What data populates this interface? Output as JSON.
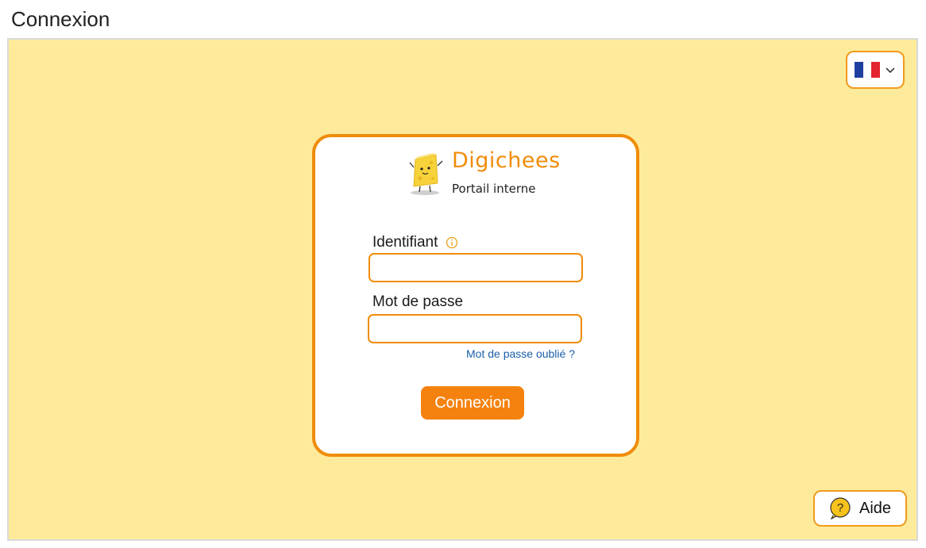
{
  "page": {
    "title": "Connexion"
  },
  "language": {
    "selected": "fr",
    "icon": "flag-fr-icon"
  },
  "brand": {
    "name": "Digichees",
    "subtitle": "Portail interne"
  },
  "form": {
    "username_label": "Identifiant",
    "username_value": "",
    "password_label": "Mot de passe",
    "password_value": "",
    "forgot_link": "Mot de passe oublié ?",
    "submit_label": "Connexion"
  },
  "help": {
    "label": "Aide"
  },
  "colors": {
    "accent": "#f08c0a",
    "background": "#fdeb9b",
    "link": "#1a5ea8",
    "button": "#f5820f"
  }
}
